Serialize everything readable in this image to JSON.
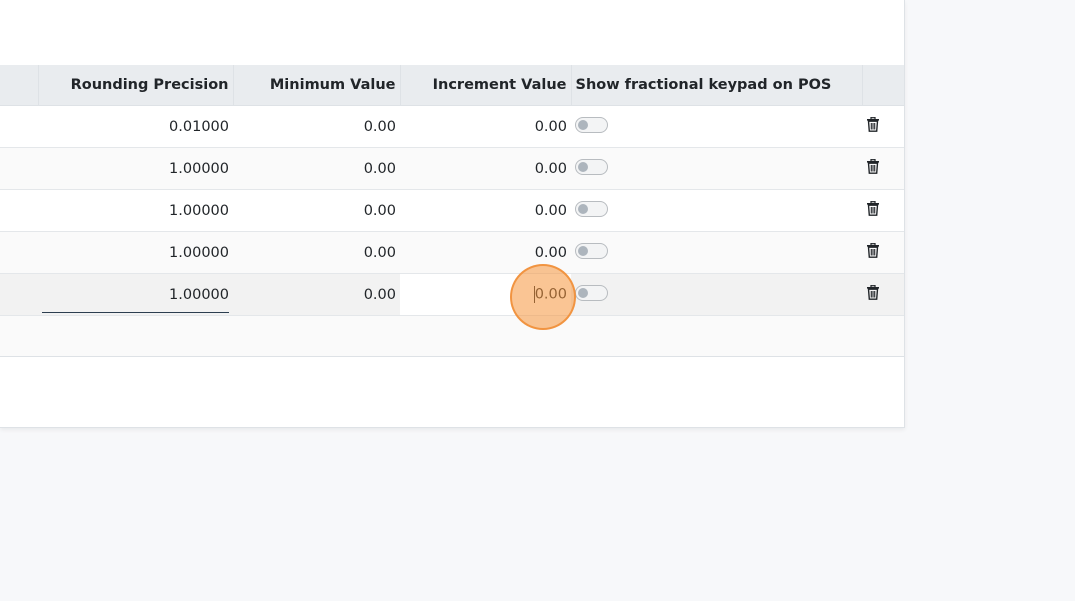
{
  "table": {
    "headers": {
      "rounding_precision": "Rounding Precision",
      "minimum_value": "Minimum Value",
      "increment_value": "Increment Value",
      "fractional_keypad": "Show fractional keypad on POS"
    },
    "rows": [
      {
        "rounding_precision": "0.01000",
        "minimum_value": "0.00",
        "increment_value": "0.00",
        "fractional_keypad": false
      },
      {
        "rounding_precision": "1.00000",
        "minimum_value": "0.00",
        "increment_value": "0.00",
        "fractional_keypad": false
      },
      {
        "rounding_precision": "1.00000",
        "minimum_value": "0.00",
        "increment_value": "0.00",
        "fractional_keypad": false
      },
      {
        "rounding_precision": "1.00000",
        "minimum_value": "0.00",
        "increment_value": "0.00",
        "fractional_keypad": false
      },
      {
        "rounding_precision": "1.00000",
        "minimum_value": "0.00",
        "increment_value": "0.00",
        "fractional_keypad": false
      }
    ],
    "editing_row": 4,
    "editing_field": "increment_value"
  },
  "colors": {
    "header_bg": "#e9ecef",
    "selected_row_bg": "#f2f2f2",
    "click_indicator": "#f5963c"
  },
  "icons": {
    "delete": "trash-icon",
    "toggle": "toggle-switch"
  }
}
